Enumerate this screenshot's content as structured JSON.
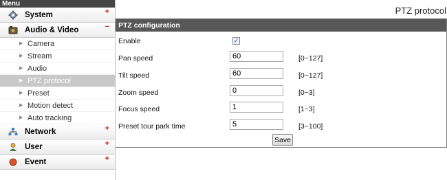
{
  "sidebar": {
    "title": "Menu",
    "system": {
      "label": "System",
      "toggle": "+"
    },
    "audio_video": {
      "label": "Audio & Video",
      "toggle": "−"
    },
    "sub_items": [
      {
        "label": "Camera"
      },
      {
        "label": "Stream"
      },
      {
        "label": "Audio"
      },
      {
        "label": "PTZ protocol"
      },
      {
        "label": "Preset"
      },
      {
        "label": "Motion detect"
      },
      {
        "label": "Auto tracking"
      }
    ],
    "network": {
      "label": "Network",
      "toggle": "+"
    },
    "user": {
      "label": "User",
      "toggle": "+"
    },
    "event": {
      "label": "Event",
      "toggle": "+"
    }
  },
  "page": {
    "title": "PTZ protocol"
  },
  "panel": {
    "header": "PTZ configuration",
    "enable": {
      "label": "Enable",
      "checked": true,
      "check_mark": "✓"
    },
    "fields": [
      {
        "label": "Pan speed",
        "value": "60",
        "range": "[0~127]"
      },
      {
        "label": "Tilt speed",
        "value": "60",
        "range": "[0~127]"
      },
      {
        "label": "Zoom speed",
        "value": "0",
        "range": "[0~3]"
      },
      {
        "label": "Focus speed",
        "value": "1",
        "range": "[1~3]"
      },
      {
        "label": "Preset tour park time",
        "value": "5",
        "range": "[3~100]"
      }
    ],
    "save_label": "Save"
  },
  "colors": {
    "header_bg": "#575757",
    "menu_bg": "#454545",
    "active_item_bg": "#c8c8c8",
    "toggle_red": "#d02020"
  }
}
